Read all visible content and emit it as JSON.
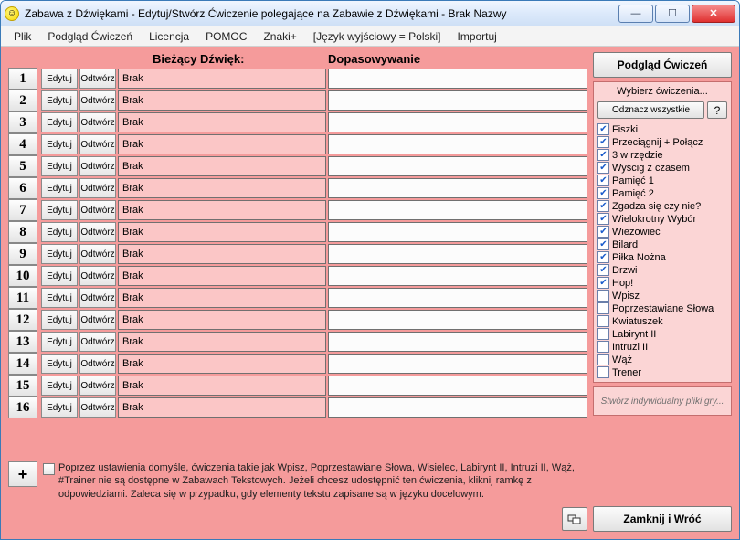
{
  "window": {
    "title": "Zabawa z Dźwiękami - Edytuj/Stwórz Ćwiczenie polegające na Zabawie z Dźwiękami - Brak Nazwy"
  },
  "menu": {
    "items": [
      "Plik",
      "Podgląd Ćwiczeń",
      "Licencja",
      "POMOC",
      "Znaki+",
      "[Język wyjściowy = Polski]",
      "Importuj"
    ]
  },
  "columns": {
    "current_sound": "Bieżący Dźwięk:",
    "matching": "Dopasowywanie"
  },
  "row_labels": {
    "edit": "Edytuj",
    "play": "Odtwórz"
  },
  "rows": [
    {
      "n": "1",
      "sound": "Brak",
      "match": ""
    },
    {
      "n": "2",
      "sound": "Brak",
      "match": ""
    },
    {
      "n": "3",
      "sound": "Brak",
      "match": ""
    },
    {
      "n": "4",
      "sound": "Brak",
      "match": ""
    },
    {
      "n": "5",
      "sound": "Brak",
      "match": ""
    },
    {
      "n": "6",
      "sound": "Brak",
      "match": ""
    },
    {
      "n": "7",
      "sound": "Brak",
      "match": ""
    },
    {
      "n": "8",
      "sound": "Brak",
      "match": ""
    },
    {
      "n": "9",
      "sound": "Brak",
      "match": ""
    },
    {
      "n": "10",
      "sound": "Brak",
      "match": ""
    },
    {
      "n": "11",
      "sound": "Brak",
      "match": ""
    },
    {
      "n": "12",
      "sound": "Brak",
      "match": ""
    },
    {
      "n": "13",
      "sound": "Brak",
      "match": ""
    },
    {
      "n": "14",
      "sound": "Brak",
      "match": ""
    },
    {
      "n": "15",
      "sound": "Brak",
      "match": ""
    },
    {
      "n": "16",
      "sound": "Brak",
      "match": ""
    }
  ],
  "plus": "+",
  "note": "Poprzez ustawienia domyśle, ćwiczenia takie jak Wpisz, Poprzestawiane Słowa, Wisielec, Labirynt II, Intruzi II, Wąż, #Trainer nie są dostępne w Zabawach Tekstowych. Jeżeli chcesz udostępnić ten ćwiczenia, kliknij ramkę z odpowiedziami. Zaleca się w przypadku, gdy elementy tekstu zapisane są w języku docelowym.",
  "right": {
    "preview": "Podgląd Ćwiczeń",
    "choose_header": "Wybierz ćwiczenia...",
    "deselect_all": "Odznacz wszystkie",
    "question": "?",
    "exercises": [
      {
        "label": "Fiszki",
        "checked": true
      },
      {
        "label": "Przeciągnij + Połącz",
        "checked": true
      },
      {
        "label": "3 w rzędzie",
        "checked": true
      },
      {
        "label": "Wyścig z czasem",
        "checked": true
      },
      {
        "label": "Pamięć 1",
        "checked": true
      },
      {
        "label": "Pamięć 2",
        "checked": true
      },
      {
        "label": "Zgadza się czy nie?",
        "checked": true
      },
      {
        "label": "Wielokrotny Wybór",
        "checked": true
      },
      {
        "label": "Wieżowiec",
        "checked": true
      },
      {
        "label": "Bilard",
        "checked": true
      },
      {
        "label": "Piłka Nożna",
        "checked": true
      },
      {
        "label": "Drzwi",
        "checked": true
      },
      {
        "label": "Hop!",
        "checked": true
      },
      {
        "label": "Wpisz",
        "checked": false
      },
      {
        "label": "Poprzestawiane Słowa",
        "checked": false
      },
      {
        "label": "Kwiatuszek",
        "checked": false
      },
      {
        "label": "Labirynt II",
        "checked": false
      },
      {
        "label": "Intruzi II",
        "checked": false
      },
      {
        "label": "Wąż",
        "checked": false
      },
      {
        "label": "Trener",
        "checked": false
      }
    ],
    "custom": "Stwórz indywidualny pliki gry..."
  },
  "footer": {
    "close": "Zamknij i Wróć"
  }
}
